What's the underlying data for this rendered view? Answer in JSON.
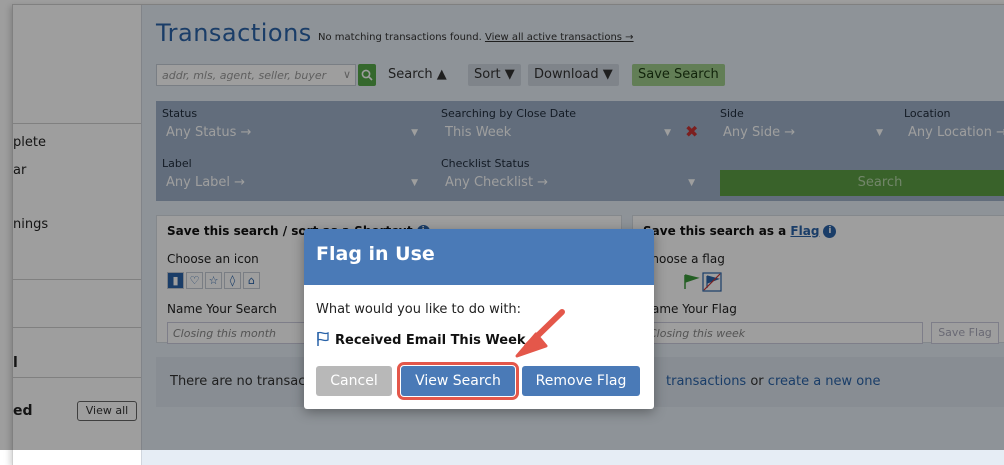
{
  "sidebar": {
    "items": [
      "plete",
      "ar",
      "nings",
      "l",
      "ed"
    ],
    "view_all": "View all"
  },
  "header": {
    "title": "Transactions",
    "message": "No matching transactions found.",
    "link": "View all active transactions →"
  },
  "toolbar": {
    "search_placeholder": "addr, mls, agent, seller, buyer",
    "search_label": "Search ▲",
    "sort_label": "Sort ▼",
    "download_label": "Download ▼",
    "save_search_label": "Save Search"
  },
  "filters": {
    "status_label": "Status",
    "status_value": "Any Status →",
    "close_date_label": "Searching by Close Date",
    "close_date_value": "This Week",
    "side_label": "Side",
    "side_value": "Any Side →",
    "location_label": "Location",
    "location_value": "Any Location →",
    "label_label": "Label",
    "label_value": "Any Label →",
    "checklist_label": "Checklist Status",
    "checklist_value": "Any Checklist →",
    "search_button": "Search"
  },
  "shortcut_panel": {
    "title": "Save this search / sort as a Shortcut",
    "choose_icon": "Choose an icon",
    "name_label": "Name Your Search",
    "name_placeholder": "Closing this month"
  },
  "flag_panel": {
    "title_prefix": "Save this search as a ",
    "title_link": "Flag",
    "choose_flag": "Choose a flag",
    "name_label": "Name Your Flag",
    "name_placeholder": "Closing this week",
    "save_button": "Save Flag"
  },
  "empty_state": {
    "prefix": "There are no transactions",
    "link1": "transactions",
    "middle": " or ",
    "link2": "create a new one"
  },
  "modal": {
    "title": "Flag in Use",
    "question": "What would you like to do with:",
    "flag_name": "Received Email This Week",
    "cancel": "Cancel",
    "view_search": "View Search",
    "remove_flag": "Remove Flag"
  },
  "colors": {
    "accent": "#4a7ab7",
    "highlight": "#e4574a",
    "green": "#5c9f44"
  }
}
